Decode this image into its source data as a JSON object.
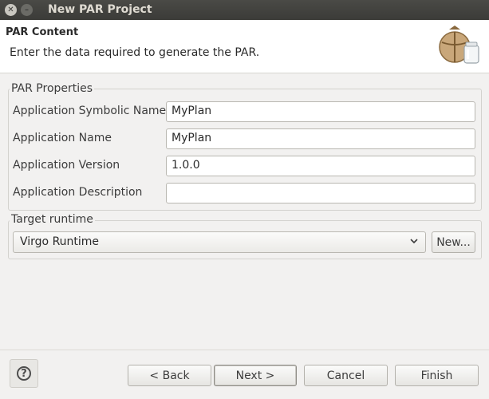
{
  "window": {
    "title": "New PAR Project"
  },
  "header": {
    "title": "PAR Content",
    "description": "Enter the data required to generate the PAR.",
    "icon": "archive-jar-icon"
  },
  "par_properties": {
    "legend": "PAR Properties",
    "fields": [
      {
        "label": "Application Symbolic Name",
        "value": "MyPlan"
      },
      {
        "label": "Application Name",
        "value": "MyPlan"
      },
      {
        "label": "Application Version",
        "value": "1.0.0"
      },
      {
        "label": "Application Description",
        "value": ""
      }
    ]
  },
  "target_runtime": {
    "legend": "Target runtime",
    "selected": "Virgo Runtime",
    "new_label": "New..."
  },
  "buttons": {
    "back": "< Back",
    "next": "Next >",
    "cancel": "Cancel",
    "finish": "Finish",
    "help": "?"
  }
}
